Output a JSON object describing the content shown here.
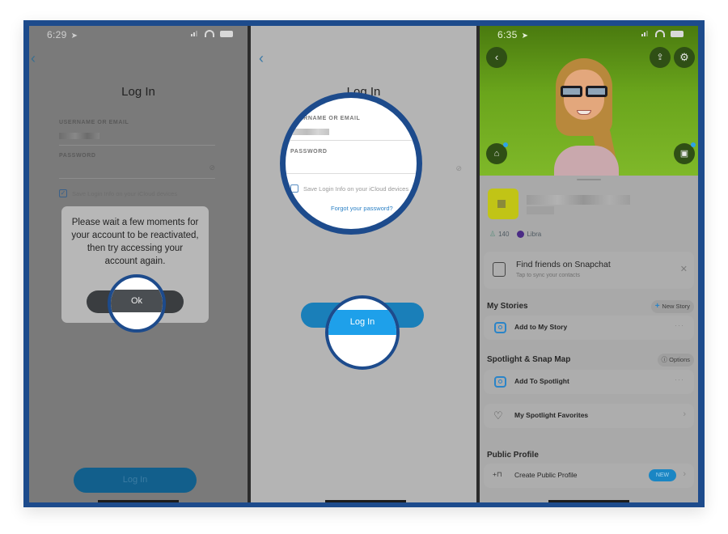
{
  "panel1": {
    "status": {
      "time": "6:29",
      "location_icon": "location-arrow-icon"
    },
    "title": "Log In",
    "username_label": "USERNAME OR EMAIL",
    "password_label": "PASSWORD",
    "save_login": "Save Login Info on your iCloud devices",
    "save_login_checked": true,
    "dialog": {
      "message": "Please wait a few moments for your account to be reactivated, then try accessing your account again.",
      "ok_label": "Ok"
    },
    "login_button": "Log In"
  },
  "panel2": {
    "title": "Log In",
    "username_label": "USERNAME OR EMAIL",
    "password_label": "PASSWORD",
    "save_login": "Save Login Info on your iCloud devices",
    "forgot_password": "Forgot your password?",
    "login_button": "Log In"
  },
  "panel3": {
    "status": {
      "time": "6:35"
    },
    "stats": {
      "friend_score": "140",
      "zodiac": "Libra"
    },
    "find_friends": {
      "title": "Find friends on Snapchat",
      "subtitle": "Tap to sync your contacts"
    },
    "my_stories": {
      "title": "My Stories",
      "action": "New Story",
      "item": "Add to My Story"
    },
    "spotlight": {
      "title": "Spotlight & Snap Map",
      "action": "Options",
      "item": "Add To Spotlight"
    },
    "favorites": "My Spotlight Favorites",
    "public_profile": {
      "title": "Public Profile",
      "item": "Create Public Profile",
      "badge": "NEW"
    },
    "colors": {
      "hero_green": "#7fb829",
      "accent_blue": "#2a84c8",
      "frame_blue": "#1d4b8c"
    }
  }
}
